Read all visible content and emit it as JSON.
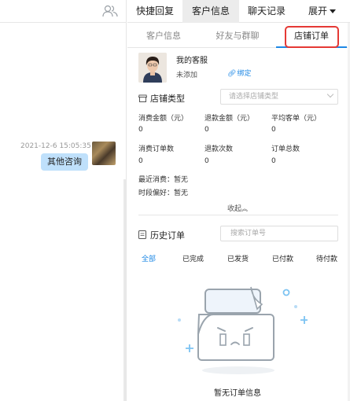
{
  "chat": {
    "message_time": "2021-12-6 15:05:35",
    "message_text": "其他咨询"
  },
  "top_tabs": [
    {
      "label": "快捷回复"
    },
    {
      "label": "客户信息"
    },
    {
      "label": "聊天记录"
    },
    {
      "label": "展开"
    }
  ],
  "sub_tabs": [
    {
      "label": "客户信息"
    },
    {
      "label": "好友与群聊"
    },
    {
      "label": "店铺订单"
    }
  ],
  "store": {
    "name": "我的客服",
    "status": "未添加",
    "bind_label": "绑定"
  },
  "store_type": {
    "label": "店铺类型",
    "placeholder": "请选择店铺类型"
  },
  "stats": [
    {
      "label": "消费金额（元）",
      "value": "0"
    },
    {
      "label": "退款金额（元）",
      "value": "0"
    },
    {
      "label": "平均客单（元）",
      "value": "0"
    },
    {
      "label": "消费订单数",
      "value": "0"
    },
    {
      "label": "退款次数",
      "value": "0"
    },
    {
      "label": "订单总数",
      "value": "0"
    }
  ],
  "recent_consumption": "最近消费：暂无",
  "time_preference": "时段偏好：暂无",
  "collapse_label": "收起",
  "order_history": {
    "label": "历史订单",
    "search_placeholder": "搜索订单号",
    "tabs": [
      {
        "label": "全部"
      },
      {
        "label": "已完成"
      },
      {
        "label": "已发货"
      },
      {
        "label": "已付款"
      },
      {
        "label": "待付款"
      }
    ],
    "empty_text": "暂无订单信息"
  },
  "colors": {
    "accent": "#1e88e5",
    "highlight_border": "#e53935",
    "bubble": "#bfe0fb"
  }
}
